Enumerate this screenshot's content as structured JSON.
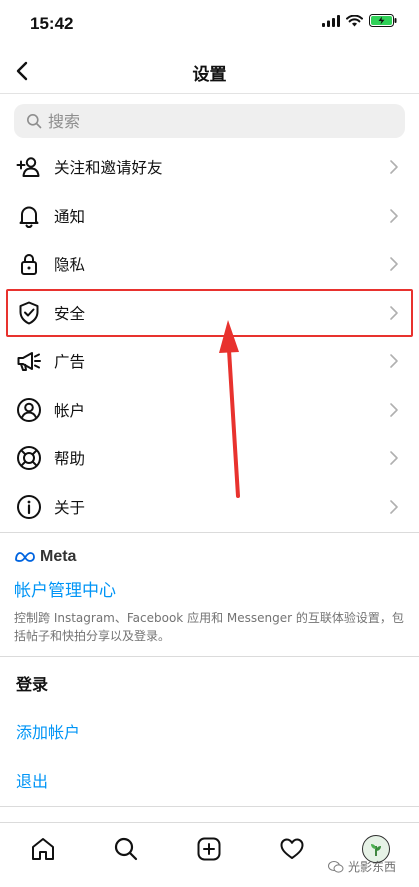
{
  "status_bar": {
    "time": "15:42"
  },
  "header": {
    "title": "设置"
  },
  "search": {
    "placeholder": "搜索"
  },
  "menu": {
    "items": [
      {
        "label": "关注和邀请好友",
        "icon": "add-person-icon"
      },
      {
        "label": "通知",
        "icon": "bell-icon"
      },
      {
        "label": "隐私",
        "icon": "lock-icon"
      },
      {
        "label": "安全",
        "icon": "shield-check-icon"
      },
      {
        "label": "广告",
        "icon": "megaphone-icon"
      },
      {
        "label": "帐户",
        "icon": "account-circle-icon"
      },
      {
        "label": "帮助",
        "icon": "lifebuoy-icon"
      },
      {
        "label": "关于",
        "icon": "info-icon"
      }
    ]
  },
  "meta": {
    "logo_text": "Meta",
    "accounts_center": "帐户管理中心",
    "description": "控制跨 Instagram、Facebook 应用和 Messenger 的互联体验设置，包括帖子和快拍分享以及登录。"
  },
  "login": {
    "heading": "登录",
    "add_account": "添加帐户",
    "logout": "退出"
  },
  "watermark": {
    "text": "光影东西"
  },
  "colors": {
    "link": "#0095f6",
    "highlight": "#e8322e"
  }
}
